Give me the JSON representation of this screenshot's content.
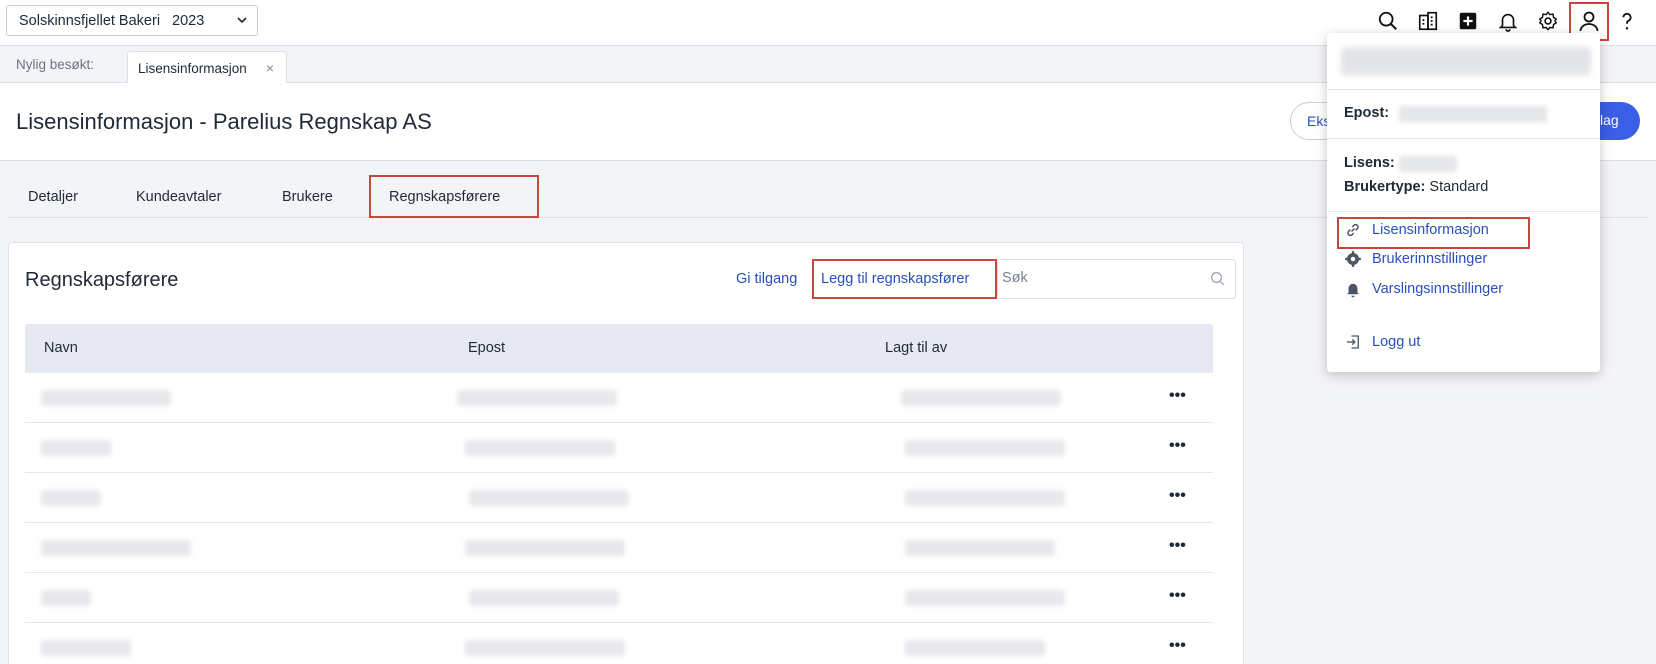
{
  "topbar": {
    "company": "Solskinnsfjellet Bakeri",
    "year": "2023",
    "icons": [
      "search-icon",
      "building-icon",
      "plus-square-icon",
      "bell-icon",
      "gear-icon",
      "user-icon",
      "help-icon"
    ]
  },
  "recent": {
    "label": "Nylig besøkt:",
    "tab": "Lisensinformasjon",
    "close": "×"
  },
  "header": {
    "title": "Lisensinformasjon - Parelius Regnskap AS",
    "export_label": "Eks",
    "primary_label": "lag"
  },
  "tabs": [
    "Detaljer",
    "Kundeavtaler",
    "Brukere",
    "Regnskapsførere"
  ],
  "card": {
    "title": "Regnskapsførere",
    "give_access": "Gi tilgang",
    "add_accountant": "Legg til regnskapsfører",
    "search_placeholder": "Søk",
    "columns": [
      "Navn",
      "Epost",
      "Lagt til av"
    ],
    "row_action": "•••",
    "row_count": 6
  },
  "user_menu": {
    "email_label": "Epost:",
    "license_label": "Lisens:",
    "usertype_label": "Brukertype:",
    "usertype_value": "Standard",
    "items": [
      {
        "label": "Lisensinformasjon",
        "icon": "link-icon"
      },
      {
        "label": "Brukerinnstillinger",
        "icon": "gear-icon"
      },
      {
        "label": "Varslingsinnstillinger",
        "icon": "bell-icon"
      }
    ],
    "logout": "Logg ut"
  },
  "colors": {
    "link": "#2a50b7",
    "primary": "#3b5ee6",
    "highlight": "#c8463d"
  }
}
